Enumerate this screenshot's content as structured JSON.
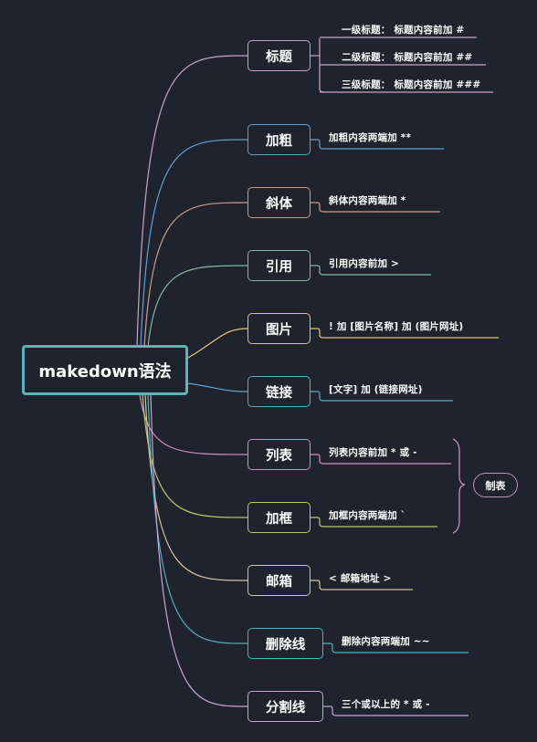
{
  "root": {
    "label": "makedown语法",
    "color": "#5cb5b5"
  },
  "topics": [
    {
      "id": "heading",
      "label": "标题",
      "color": "#c9a3c4",
      "children": [
        "一级标题：  标题内容前加  #",
        "二级标题：  标题内容前加  ##",
        "三级标题：  标题内容前加  ###"
      ]
    },
    {
      "id": "bold",
      "label": "加粗",
      "color": "#5fa0d0",
      "children": [
        "加粗内容两端加  **"
      ]
    },
    {
      "id": "italic",
      "label": "斜体",
      "color": "#d09a88",
      "children": [
        "斜体内容两端加  *"
      ]
    },
    {
      "id": "quote",
      "label": "引用",
      "color": "#86b8a3",
      "children": [
        "引用内容前加  >"
      ]
    },
    {
      "id": "image",
      "label": "图片",
      "color": "#e8c46a",
      "children": [
        "!  加  [图片名称]  加  (图片网址)"
      ]
    },
    {
      "id": "link",
      "label": "链接",
      "color": "#5fa8c8",
      "children": [
        "[文字]  加  (链接网址)"
      ]
    },
    {
      "id": "list",
      "label": "列表",
      "color": "#d38fc0",
      "children": [
        "列表内容前加  * 或  -"
      ]
    },
    {
      "id": "box",
      "label": "加框",
      "color": "#b9c96f",
      "children": [
        "加框内容两端加  `"
      ]
    },
    {
      "id": "email",
      "label": "邮箱",
      "color": "#d7c59a",
      "children": [
        "< 邮箱地址 >"
      ]
    },
    {
      "id": "strike",
      "label": "删除线",
      "color": "#4fb3bf",
      "children": [
        "删除内容两端加  ~~"
      ]
    },
    {
      "id": "hr",
      "label": "分割线",
      "color": "#c9a3d4",
      "children": [
        "三个或以上的  * 或  -"
      ]
    }
  ],
  "summary": {
    "label": "制表",
    "color": "#c48fb2"
  }
}
